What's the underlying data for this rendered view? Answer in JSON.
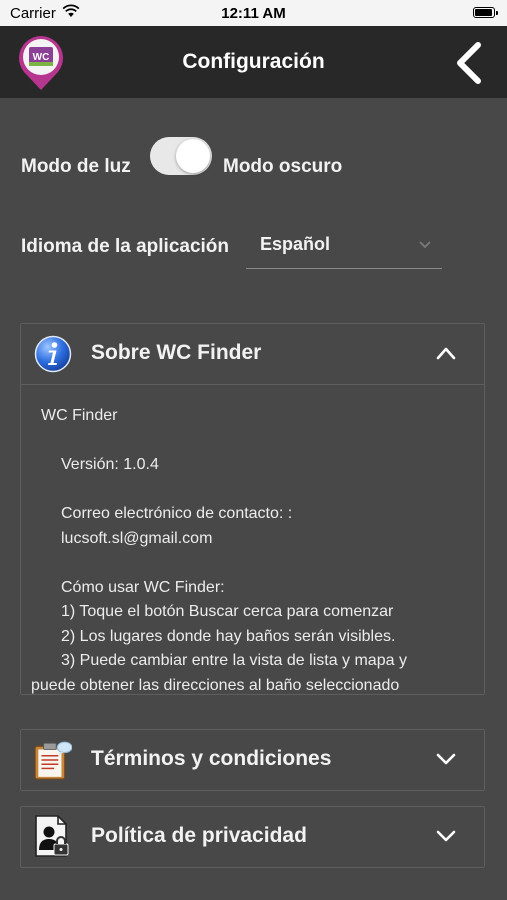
{
  "status_bar": {
    "carrier": "Carrier",
    "time": "12:11 AM"
  },
  "header": {
    "title": "Configuración",
    "logo_text": "WC",
    "colors": {
      "bar": "#282828",
      "logo_pin": "#b5358f"
    }
  },
  "settings": {
    "light_mode_label": "Modo de luz",
    "dark_mode_label": "Modo oscuro",
    "dark_mode_enabled": true,
    "language_label": "Idioma de la aplicación",
    "language_value": "Español"
  },
  "about": {
    "title": "Sobre WC Finder",
    "expanded": true,
    "lines": {
      "name": "WC Finder",
      "version": "Versión:  1.0.4",
      "contact_label": "Correo electrónico de contacto: :",
      "contact_email": "lucsoft.sl@gmail.com",
      "howto_title": "Cómo usar WC Finder:",
      "step1": "1) Toque el botón Buscar cerca para comenzar",
      "step2": "2) Los lugares donde hay baños serán visibles.",
      "step3a": "3) Puede cambiar entre la vista de lista y mapa y",
      "step3b": "puede obtener las direcciones al baño seleccionado"
    }
  },
  "terms": {
    "title": "Términos y condiciones",
    "expanded": false
  },
  "privacy": {
    "title": "Política de privacidad",
    "expanded": false
  }
}
